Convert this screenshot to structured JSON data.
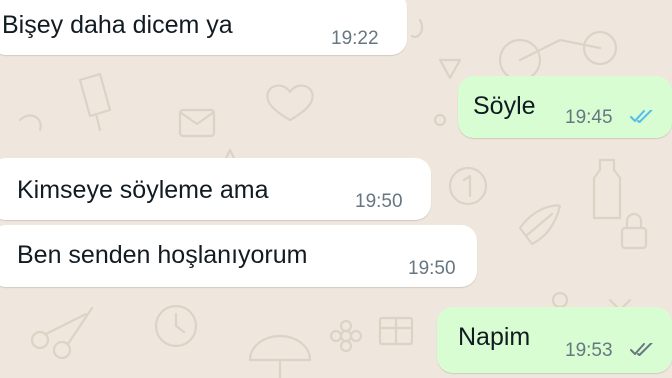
{
  "messages": [
    {
      "direction": "incoming",
      "text": "Bişey daha dicem ya",
      "time": "19:22"
    },
    {
      "direction": "outgoing",
      "text": "Söyle",
      "time": "19:45",
      "status": "read",
      "status_icon": "double-check-icon"
    },
    {
      "direction": "incoming",
      "text": "Kimseye söyleme ama",
      "time": "19:50"
    },
    {
      "direction": "incoming",
      "text": "Ben senden hoşlanıyorum",
      "time": "19:50"
    },
    {
      "direction": "outgoing",
      "text": "Napim",
      "time": "19:53",
      "status": "delivered",
      "status_icon": "double-check-icon"
    }
  ],
  "colors": {
    "background": "#efe7dd",
    "incoming_bubble": "#ffffff",
    "outgoing_bubble": "#d9fdd3",
    "read_ticks": "#53bdeb",
    "delivered_ticks": "#667781",
    "text": "#111b21",
    "timestamp": "#667781"
  }
}
